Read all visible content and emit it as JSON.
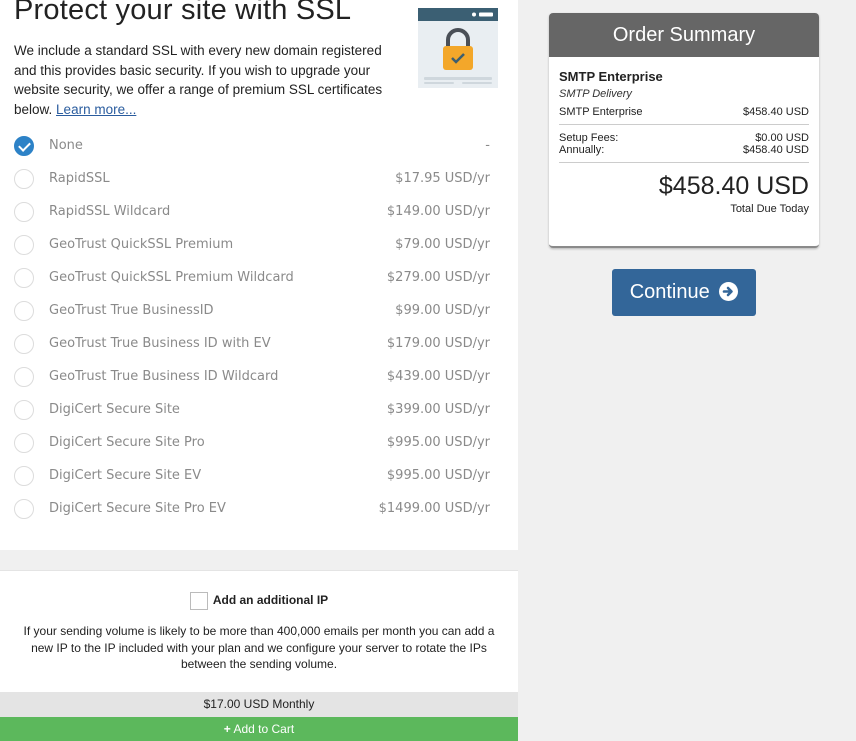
{
  "ssl": {
    "title": "Protect your site with SSL",
    "description": "We include a standard SSL with every new domain registered and this provides basic security. If you wish to upgrade your website security, we offer a range of premium SSL certificates below.",
    "learn_more": "Learn more...",
    "options": [
      {
        "name": "None",
        "price": "-",
        "selected": true
      },
      {
        "name": "RapidSSL",
        "price": "$17.95 USD/yr"
      },
      {
        "name": "RapidSSL Wildcard",
        "price": "$149.00 USD/yr"
      },
      {
        "name": "GeoTrust QuickSSL Premium",
        "price": "$79.00 USD/yr"
      },
      {
        "name": "GeoTrust QuickSSL Premium Wildcard",
        "price": "$279.00 USD/yr"
      },
      {
        "name": "GeoTrust True BusinessID",
        "price": "$99.00 USD/yr"
      },
      {
        "name": "GeoTrust True Business ID with EV",
        "price": "$179.00 USD/yr"
      },
      {
        "name": "GeoTrust True Business ID Wildcard",
        "price": "$439.00 USD/yr"
      },
      {
        "name": "DigiCert Secure Site",
        "price": "$399.00 USD/yr"
      },
      {
        "name": "DigiCert Secure Site Pro",
        "price": "$995.00 USD/yr"
      },
      {
        "name": "DigiCert Secure Site EV",
        "price": "$995.00 USD/yr"
      },
      {
        "name": "DigiCert Secure Site Pro EV",
        "price": "$1499.00 USD/yr"
      }
    ]
  },
  "addon": {
    "checkbox_label": "Add an additional IP",
    "description": "If your sending volume is likely to be more than 400,000 emails per month you can add a new IP to the IP included with your plan and we configure your server to rotate the IPs between the sending volume.",
    "price": "$17.00 USD Monthly",
    "add_to_cart": "Add to Cart"
  },
  "order_summary": {
    "title": "Order Summary",
    "product": "SMTP Enterprise",
    "group": "SMTP Delivery",
    "line_item": {
      "label": "SMTP Enterprise",
      "value": "$458.40 USD"
    },
    "setup_fees": {
      "label": "Setup Fees:",
      "value": "$0.00 USD"
    },
    "annually": {
      "label": "Annually:",
      "value": "$458.40 USD"
    },
    "total": "$458.40 USD",
    "total_label": "Total Due Today"
  },
  "continue_label": "Continue",
  "colors": {
    "accent_blue": "#2d82c7",
    "continue_blue": "#336699",
    "add_to_cart_green": "#5cb85c",
    "summary_header": "#666666"
  },
  "icons": {
    "ssl_image": "padlock-browser-icon",
    "continue": "arrow-circle-right-icon",
    "add_to_cart": "plus-icon"
  }
}
